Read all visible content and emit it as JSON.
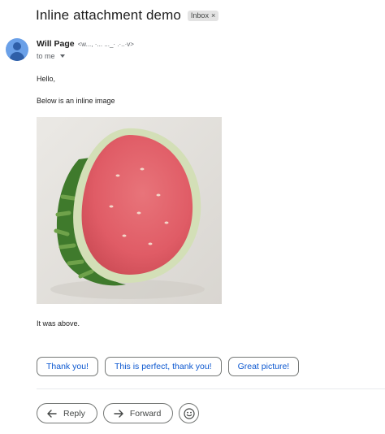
{
  "subject": "Inline attachment demo",
  "label": {
    "text": "Inbox",
    "remove": "×"
  },
  "sender": {
    "name": "Will Page",
    "email": "<w..., ·... ..._· .·..·v>"
  },
  "recipient": {
    "text": "to me"
  },
  "body": {
    "greeting": "Hello,",
    "intro": "Below is an inline image",
    "outro": "It was above."
  },
  "smart_replies": [
    "Thank you!",
    "This is perfect, thank you!",
    "Great picture!"
  ],
  "actions": {
    "reply": "Reply",
    "forward": "Forward"
  },
  "icons": {
    "avatar": "person-avatar-icon",
    "reply": "reply-arrow-icon",
    "forward": "forward-arrow-icon",
    "emoji": "smiley-face-icon",
    "recipient_details": "caret-down-icon"
  },
  "colors": {
    "avatar_bg": "#6aa0e8",
    "chip_text": "#0b57d0",
    "label_bg": "#e3e3e3"
  }
}
